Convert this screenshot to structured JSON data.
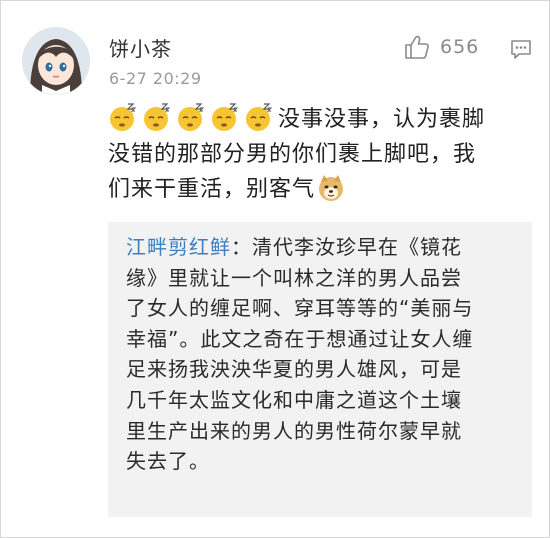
{
  "comment": {
    "username": "饼小茶",
    "timestamp": "6-27 20:29",
    "like_count": "656",
    "emoji_sleep": "😴",
    "emoji_doge": "🐶",
    "text_line1": "没事没事，认为裹脚",
    "text_line2": "没错的那部分男的你们裹上脚吧，我",
    "text_line3": "们来干重活，别客气"
  },
  "reply": {
    "author": "江畔剪红鲜",
    "line1": "：清代李汝珍早在《镜花",
    "line2": "缘》里就让一个叫林之洋的男人品尝",
    "line3": "了女人的缠足啊、穿耳等等的“美丽与",
    "line4": "幸福”。此文之奇在于想通过让女人缠",
    "line5": "足来扬我泱泱华夏的男人雄风，可是",
    "line6": "几千年太监文化和中庸之道这个土壤",
    "line7": "里生产出来的男人的男性荷尔蒙早就",
    "line8": "失去了。"
  },
  "icons": {
    "like": "thumbs-up-icon",
    "comment": "comment-icon",
    "avatar": "anime-girl-avatar",
    "emoji": "sleepy-face-emoji",
    "doge": "doge-emoji"
  },
  "colors": {
    "author_link": "#3a7fc1",
    "quote_bg": "#f2f2f2",
    "timestamp": "#9a9a9a"
  }
}
